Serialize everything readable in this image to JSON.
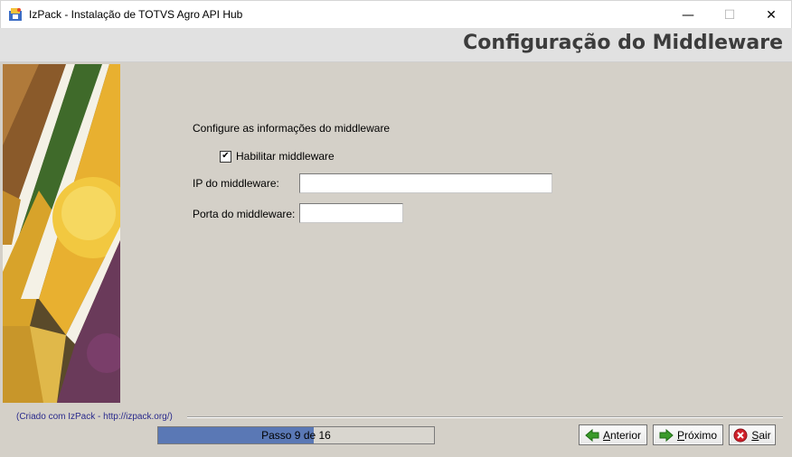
{
  "window": {
    "title": "IzPack - Instalação de TOTVS Agro API Hub",
    "controls": {
      "minimize": "—",
      "maximize": "☐",
      "close": "✕"
    }
  },
  "header": {
    "title": "Configuração do Middleware"
  },
  "form": {
    "heading": "Configure as informações do middleware",
    "enable_middleware": {
      "label": "Habilitar middleware",
      "checked": true,
      "check_glyph": "✔"
    },
    "ip": {
      "label": "IP do middleware:",
      "value": ""
    },
    "port": {
      "label": "Porta do middleware:",
      "value": ""
    }
  },
  "footer": {
    "credit": "(Criado com IzPack - http://izpack.org/)",
    "progress": {
      "text": "Passo 9 de 16",
      "current": 9,
      "total": 16
    },
    "buttons": {
      "previous": {
        "mnemonic": "A",
        "rest": "nterior",
        "icon": "arrow-left-icon"
      },
      "next": {
        "mnemonic": "P",
        "rest": "róximo",
        "icon": "arrow-right-icon"
      },
      "quit": {
        "mnemonic": "S",
        "rest": "air",
        "icon": "close-circle-icon"
      }
    }
  },
  "colors": {
    "progress_fill": "#5a78b5",
    "header_text": "#3c3c3c",
    "next_icon": "#3a9a2a",
    "quit_icon": "#d0202a"
  }
}
